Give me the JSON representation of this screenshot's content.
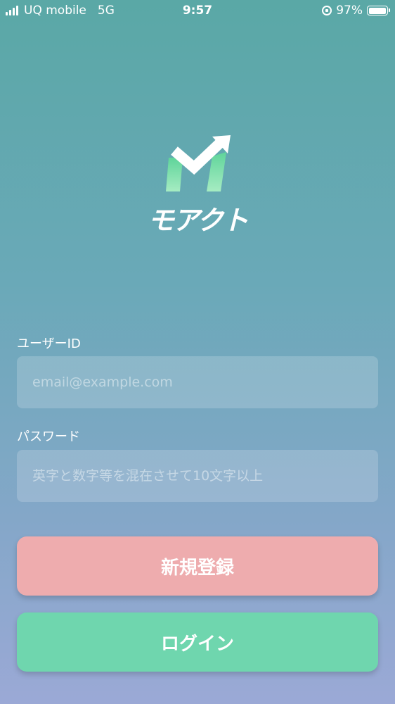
{
  "status_bar": {
    "carrier": "UQ mobile",
    "network": "5G",
    "time": "9:57",
    "battery": "97%",
    "battery_level": 0.97
  },
  "logo": {
    "wordmark": "モアクト"
  },
  "form": {
    "user_id_label": "ユーザーID",
    "user_id_placeholder": "email@example.com",
    "user_id_value": "",
    "password_label": "パスワード",
    "password_placeholder": "英字と数字等を混在させて10文字以上",
    "password_value": ""
  },
  "buttons": {
    "register_label": "新規登録",
    "login_label": "ログイン"
  },
  "colors": {
    "register_button": "#eeacae",
    "login_button": "#6fd6ae",
    "logo_green": "#7be0a6"
  }
}
